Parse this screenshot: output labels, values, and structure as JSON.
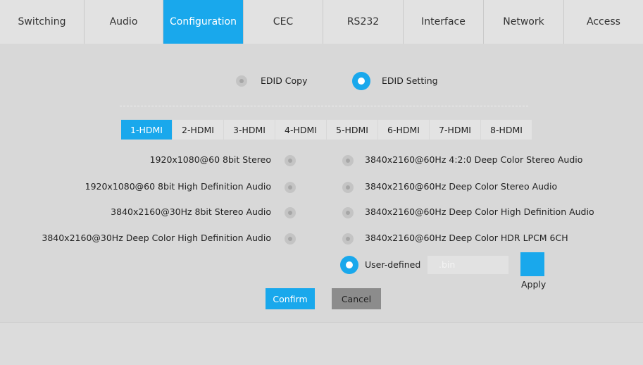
{
  "nav": {
    "tabs": [
      {
        "label": "Switching",
        "active": false
      },
      {
        "label": "Audio",
        "active": false
      },
      {
        "label": "Configuration",
        "active": true
      },
      {
        "label": "CEC",
        "active": false
      },
      {
        "label": "RS232",
        "active": false
      },
      {
        "label": "Interface",
        "active": false
      },
      {
        "label": "Network",
        "active": false
      },
      {
        "label": "Access",
        "active": false
      }
    ]
  },
  "edid": {
    "mode_copy_label": "EDID Copy",
    "mode_setting_label": "EDID Setting",
    "selected_mode": "EDID Setting",
    "hdmi_tabs": [
      "1-HDMI",
      "2-HDMI",
      "3-HDMI",
      "4-HDMI",
      "5-HDMI",
      "6-HDMI",
      "7-HDMI",
      "8-HDMI"
    ],
    "active_hdmi_tab": "1-HDMI",
    "left_options": [
      "1920x1080@60 8bit Stereo",
      "1920x1080@60 8bit High Definition Audio",
      "3840x2160@30Hz 8bit Stereo Audio",
      "3840x2160@30Hz Deep Color High Definition Audio"
    ],
    "right_options": [
      "3840x2160@60Hz 4:2:0 Deep Color Stereo Audio",
      "3840x2160@60Hz Deep Color Stereo Audio",
      "3840x2160@60Hz Deep Color High Definition Audio",
      "3840x2160@60Hz Deep Color HDR LPCM 6CH"
    ],
    "user_defined_label": "User-defined",
    "selected_option": "User-defined",
    "file_placeholder": ".bin",
    "apply_label": "Apply",
    "confirm_label": "Confirm",
    "cancel_label": "Cancel"
  },
  "colors": {
    "accent": "#19a8ec",
    "background": "#d8d8d8",
    "cancel_button": "#8c8c8c"
  }
}
